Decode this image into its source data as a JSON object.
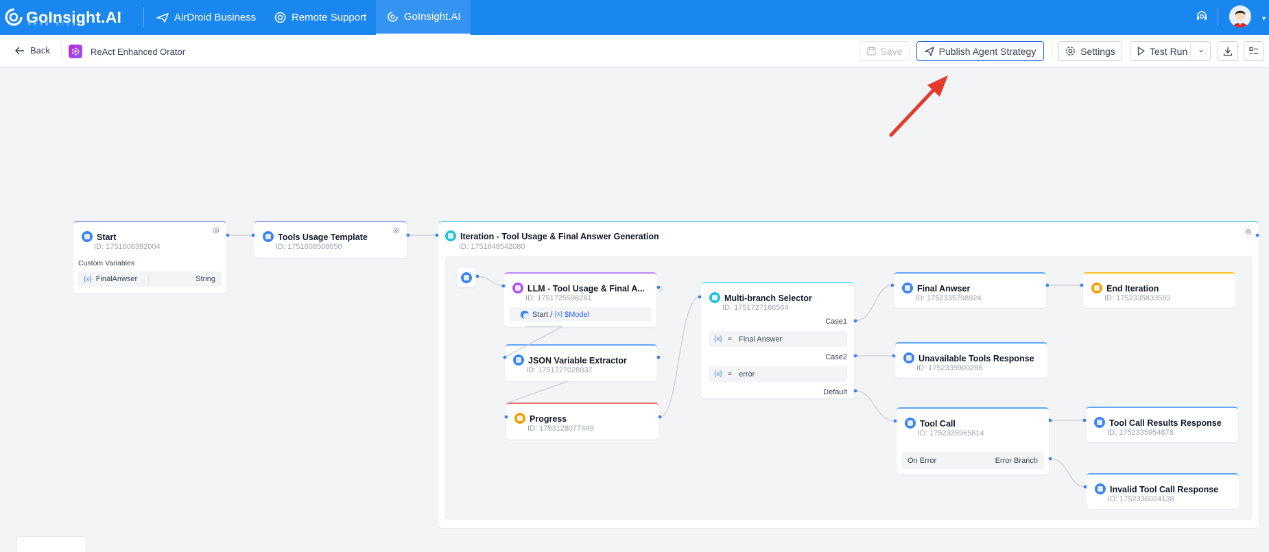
{
  "topbar": {
    "logo_text": "GoInsight.AI",
    "logo_sub": "Send Studio",
    "tabs": [
      {
        "label": "AirDroid Business",
        "icon": "paper-plane-icon"
      },
      {
        "label": "Remote Support",
        "icon": "lifebuoy-icon"
      },
      {
        "label": "GoInsight.AI",
        "icon": "goinsight-icon"
      }
    ],
    "active_tab": "GoInsight.AI",
    "colors": {
      "bar": "#1a86f0"
    }
  },
  "toolbar": {
    "back_label": "Back",
    "agent_name": "ReAct Enhanced Orator",
    "save_label": "Save",
    "publish_label": "Publish Agent Strategy",
    "settings_label": "Settings",
    "test_run_label": "Test Run"
  },
  "nodes": {
    "start": {
      "title": "Start",
      "id": "ID: 1751608392004",
      "section": "Custom Variables",
      "var_name": "FinalAnwser",
      "var_type": "String"
    },
    "tools_usage_template": {
      "title": "Tools Usage Template",
      "id": "ID: 1751608508650"
    },
    "iteration": {
      "title": "Iteration - Tool Usage & Final Answer Generation",
      "id": "ID: 1751648542080"
    },
    "llm": {
      "title": "LLM - Tool Usage & Final A...",
      "id": "ID: 1751725598281",
      "ref_node": "Start",
      "ref_sep": "/",
      "ref_var": "$Model"
    },
    "json_extractor": {
      "title": "JSON Variable Extractor",
      "id": "ID: 1751727028037"
    },
    "progress": {
      "title": "Progress",
      "id": "ID: 1753128077449"
    },
    "multi_branch": {
      "title": "Multi-branch Selector",
      "id": "ID: 1751727166564",
      "case1": "Case1",
      "case2": "Case2",
      "default": "Default",
      "case1_op": "=",
      "case1_value": "Final Answer",
      "case2_op": "=",
      "case2_value": "error"
    },
    "final_answer": {
      "title": "Final Anwser",
      "id": "ID: 1752335798924"
    },
    "end_iteration": {
      "title": "End Iteration",
      "id": "ID: 1752335833582"
    },
    "unavailable_tools": {
      "title": "Unavailable Tools Response",
      "id": "ID: 1752335900288"
    },
    "tool_call": {
      "title": "Tool Call",
      "id": "ID: 1752335965814",
      "on_error": "On Error",
      "error_branch": "Error Branch"
    },
    "tool_call_results": {
      "title": "Tool Call Results Response",
      "id": "ID: 1752335954878"
    },
    "invalid_tool_call": {
      "title": "Invalid Tool Call Response",
      "id": "ID: 1752336024138"
    }
  },
  "variable_glyph": "{x}",
  "annotation": {
    "color": "#e5392c"
  }
}
